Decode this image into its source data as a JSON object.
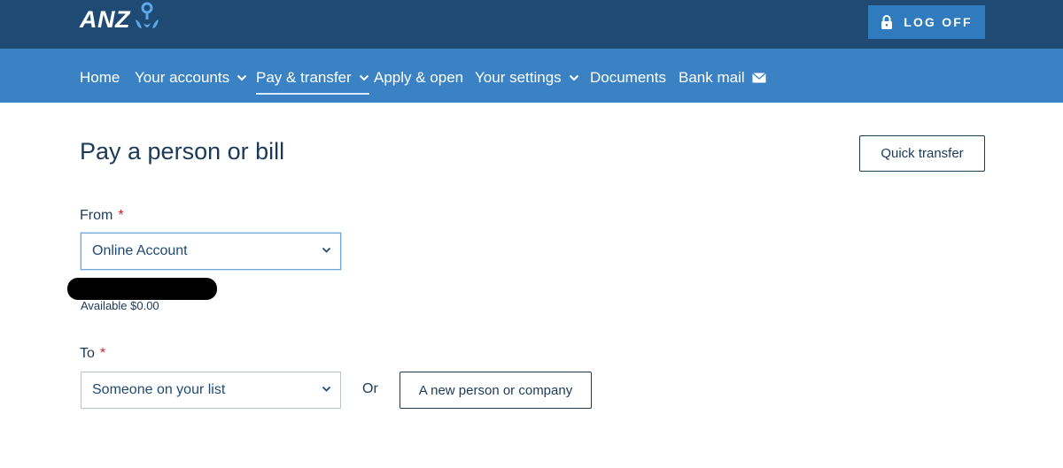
{
  "header": {
    "logo_text": "ANZ",
    "logoff_label": "LOG OFF"
  },
  "nav": {
    "home": "Home",
    "accounts": "Your accounts",
    "pay": "Pay & transfer",
    "apply": "Apply & open",
    "settings": "Your settings",
    "documents": "Documents",
    "bankmail": "Bank mail"
  },
  "page": {
    "title": "Pay a person or bill",
    "quick_transfer": "Quick transfer"
  },
  "from": {
    "label": "From",
    "required_mark": "*",
    "selected": "Online Account",
    "available": "Available $0.00"
  },
  "to": {
    "label": "To",
    "required_mark": "*",
    "selected": "Someone on your list",
    "or_text": "Or",
    "new_person_button": "A new person or company"
  },
  "colors": {
    "topbar": "#1f4a74",
    "navbar": "#3a82c4",
    "logoff_button": "#2f7bbd",
    "required": "#d21e2b",
    "text": "#1b3a57"
  }
}
